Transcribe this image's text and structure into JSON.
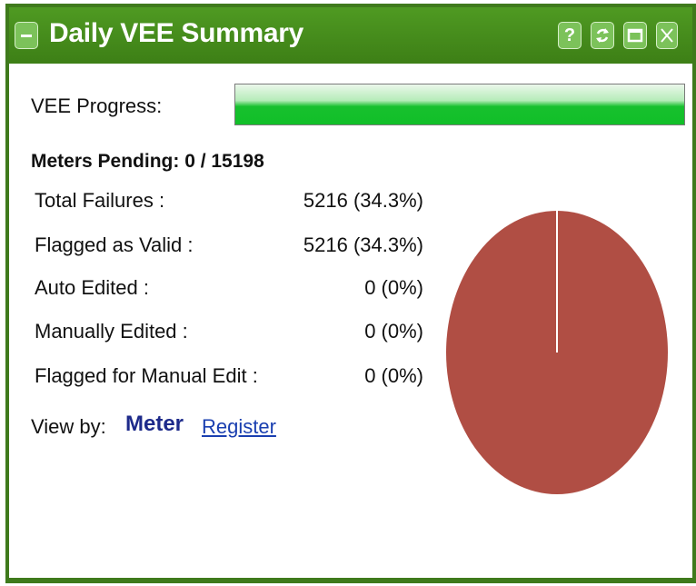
{
  "window": {
    "title": "Daily VEE Summary",
    "help_label": "?"
  },
  "progress": {
    "label": "VEE Progress:",
    "value": 1.0
  },
  "pending": {
    "text": "Meters Pending: 0 / 15198"
  },
  "stats": [
    {
      "label": "Total Failures :",
      "value": "5216 (34.3%)"
    },
    {
      "label": "Flagged as Valid :",
      "value": "5216 (34.3%)"
    },
    {
      "label": "Auto Edited :",
      "value": "0 (0%)"
    },
    {
      "label": "Manually Edited :",
      "value": "0 (0%)"
    },
    {
      "label": "Flagged for Manual Edit :",
      "value": "0 (0%)"
    }
  ],
  "view_by": {
    "label": "View by:",
    "selected": "Meter",
    "link": "Register"
  },
  "colors": {
    "titlebar": "#4a8f1f",
    "progress_fill": "#14bf2b",
    "pie_slice": "#b04e44",
    "link": "#1a3fb0"
  },
  "chart_data": {
    "type": "pie",
    "slices": [
      {
        "value": 5216
      },
      {
        "value": 0
      },
      {
        "value": 0
      }
    ]
  }
}
